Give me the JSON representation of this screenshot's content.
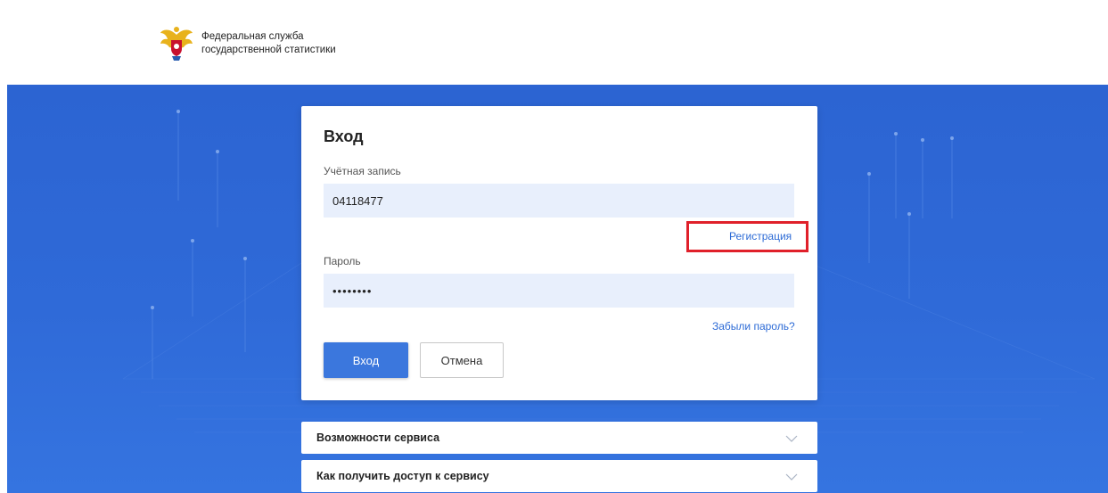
{
  "header": {
    "org_line1": "Федеральная служба",
    "org_line2": "государственной статистики",
    "logo_icon": "double-headed-eagle-emblem"
  },
  "login": {
    "title": "Вход",
    "account_label": "Учётная запись",
    "account_value": "04118477",
    "register_link": "Регистрация",
    "password_label": "Пароль",
    "password_value": "••••••••",
    "forgot_link": "Забыли пароль?",
    "submit_label": "Вход",
    "cancel_label": "Отмена"
  },
  "accordion": [
    {
      "label": "Возможности сервиса",
      "icon": "chevron-down-icon"
    },
    {
      "label": "Как получить доступ к сервису",
      "icon": "chevron-down-icon"
    }
  ],
  "colors": {
    "hero_bg": "#2f6ad8",
    "input_bg": "#e8effc",
    "primary_button": "#3b77dd",
    "link": "#2d6bd6",
    "highlight_border": "#e0202a"
  }
}
